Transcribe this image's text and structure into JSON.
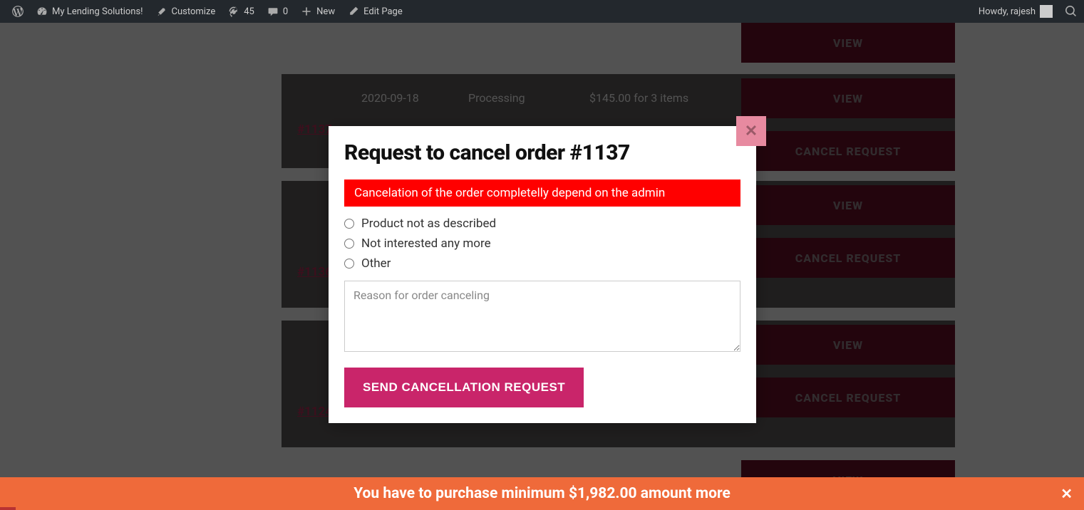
{
  "adminbar": {
    "site_name": "My Lending Solutions!",
    "customize": "Customize",
    "updates_count": "45",
    "comments_count": "0",
    "new_label": "New",
    "edit_page": "Edit Page",
    "howdy": "Howdy, rajesh"
  },
  "orders": [
    {
      "id": "#1137",
      "date": "2020-09-18",
      "status": "Processing",
      "total": "$145.00 for 3 items"
    },
    {
      "id": "#1136",
      "date": "",
      "status": "",
      "total": ""
    },
    {
      "id": "#1124",
      "date": "",
      "status": "",
      "total": ""
    }
  ],
  "actions": {
    "view": "VIEW",
    "cancel_request": "CANCEL REQUEST"
  },
  "modal": {
    "title": "Request to cancel order #1137",
    "warning": "Cancelation of the order completelly depend on the admin",
    "reasons": [
      "Product not as described",
      "Not interested any more",
      "Other"
    ],
    "textarea_placeholder": "Reason for order canceling",
    "send_button": "SEND CANCELLATION REQUEST"
  },
  "banner": {
    "text": "You have to purchase minimum $1,982.00 amount more"
  }
}
